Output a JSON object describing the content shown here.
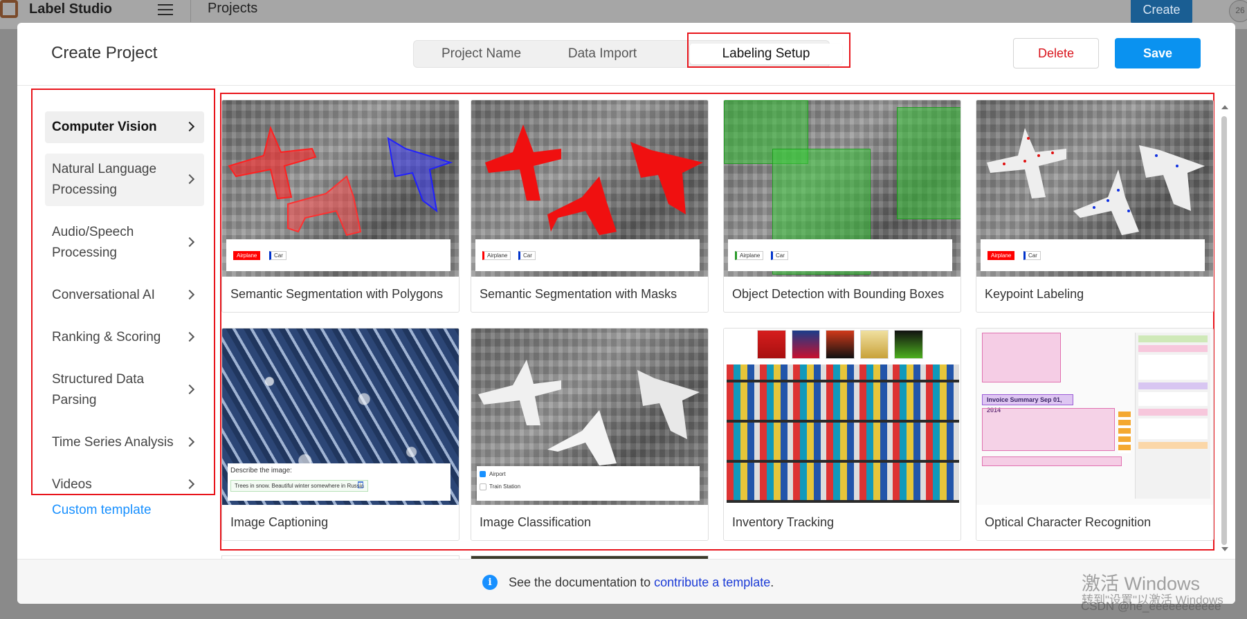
{
  "app": {
    "brand": "Label Studio",
    "page_crumb": "Projects",
    "create_label": "Create",
    "avatar_text": "26"
  },
  "modal": {
    "title": "Create Project",
    "steps": [
      {
        "label": "Project Name"
      },
      {
        "label": "Data Import"
      },
      {
        "label": "Labeling Setup",
        "active": true
      }
    ],
    "delete_label": "Delete",
    "save_label": "Save"
  },
  "sidebar": {
    "items": [
      {
        "label": "Computer Vision",
        "active": true
      },
      {
        "label": "Natural Language Processing"
      },
      {
        "label": "Audio/Speech Processing"
      },
      {
        "label": "Conversational AI"
      },
      {
        "label": "Ranking & Scoring"
      },
      {
        "label": "Structured Data Parsing"
      },
      {
        "label": "Time Series Analysis"
      },
      {
        "label": "Videos"
      }
    ],
    "custom_template": "Custom template"
  },
  "templates": [
    {
      "title": "Semantic Segmentation with Polygons",
      "labels": [
        "Airplane",
        "Car"
      ]
    },
    {
      "title": "Semantic Segmentation with Masks",
      "labels": [
        "Airplane",
        "Car"
      ]
    },
    {
      "title": "Object Detection with Bounding Boxes",
      "labels": [
        "Airplane",
        "Car"
      ]
    },
    {
      "title": "Keypoint Labeling",
      "labels": [
        "Airplane",
        "Car"
      ]
    },
    {
      "title": "Image Captioning",
      "prompt": "Describe the image:",
      "caption": "Trees in snow. Beautiful winter somewhere in Russia"
    },
    {
      "title": "Image Classification",
      "choices": [
        "Airport",
        "Train Station"
      ]
    },
    {
      "title": "Inventory Tracking"
    },
    {
      "title": "Optical Character Recognition",
      "ocr_heading": "Invoice Summary Sep 01, 2014"
    }
  ],
  "footer": {
    "prefix": "See the documentation to ",
    "link": "contribute a template",
    "suffix": "."
  },
  "overlay": {
    "watermark_line1": "激活 Windows",
    "watermark_line2": "转到\"设置\"以激活 Windows",
    "csdn": "CSDN @he_eeeeeeeeeee"
  },
  "colors": {
    "primary": "#0a92f0",
    "danger": "#d9131b",
    "link": "#1890ff",
    "highlight": "#e8141b"
  }
}
